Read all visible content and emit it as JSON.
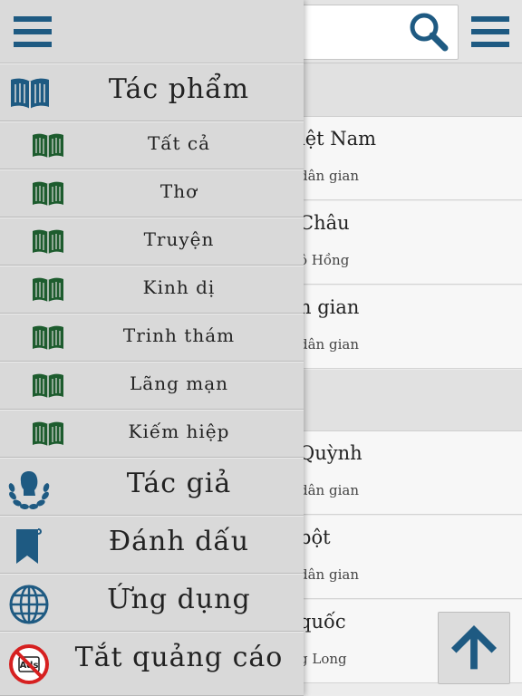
{
  "header": {
    "left_menu_icon": "hamburger-menu-icon",
    "right_menu_icon": "hamburger-menu-icon",
    "search_icon": "magnifier-icon",
    "search_value": ""
  },
  "list": {
    "rows": [
      {
        "title": "iệt Nam",
        "subtitle": "dân gian"
      },
      {
        "title": "Châu",
        "subtitle": "ô Hồng"
      },
      {
        "title": "n gian",
        "subtitle": "dân gian"
      },
      {
        "title": "Quỳnh",
        "subtitle": "dân gian"
      },
      {
        "title": "bột",
        "subtitle": "dân gian"
      },
      {
        "title": "quốc",
        "subtitle": "g Long"
      }
    ],
    "scroll_top_icon": "arrow-up-icon"
  },
  "drawer": {
    "works": {
      "label": "Tác phẩm",
      "icon": "open-book-icon"
    },
    "genres": [
      {
        "label": "Tất cả",
        "icon": "open-book-icon"
      },
      {
        "label": "Thơ",
        "icon": "open-book-icon"
      },
      {
        "label": "Truyện",
        "icon": "open-book-icon"
      },
      {
        "label": "Kinh dị",
        "icon": "open-book-icon"
      },
      {
        "label": "Trinh thám",
        "icon": "open-book-icon"
      },
      {
        "label": "Lãng mạn",
        "icon": "open-book-icon"
      },
      {
        "label": "Kiếm hiệp",
        "icon": "open-book-icon"
      }
    ],
    "authors": {
      "label": "Tác giả",
      "icon": "laurel-head-icon"
    },
    "bookmarks": {
      "label": "Đánh dấu",
      "icon": "bookmark-icon"
    },
    "apps": {
      "label": "Ứng dụng",
      "icon": "globe-icon"
    },
    "remove_ads": {
      "label": "Tắt quảng cáo",
      "icon": "no-ads-icon"
    }
  },
  "colors": {
    "icon_blue": "#1e5a82",
    "book_green": "#1d5c2e",
    "no_ads_red": "#d62020"
  }
}
